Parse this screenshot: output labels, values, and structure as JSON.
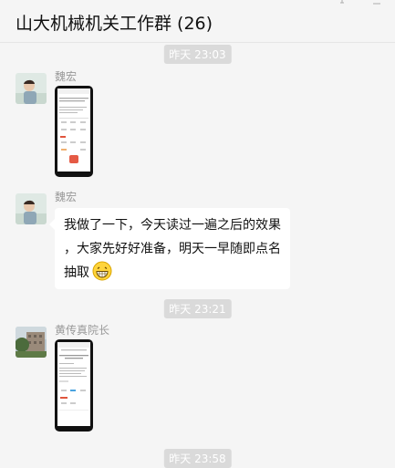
{
  "window": {
    "title": "山大机械机关工作群 (26)"
  },
  "messages": [
    {
      "type": "time",
      "text": "昨天 23:03"
    },
    {
      "type": "image",
      "sender": "魏宏",
      "avatar": "person-avatar",
      "image": "phone-screenshot-thumbnail"
    },
    {
      "type": "text",
      "sender": "魏宏",
      "avatar": "person-avatar",
      "lines": [
        "我做了一下，今天读过一遍之后的效果",
        "，大家先好好准备，明天一早随即点名",
        "抽取"
      ],
      "emoji": "grin-emoji"
    },
    {
      "type": "time",
      "text": "昨天 23:21"
    },
    {
      "type": "image",
      "sender": "黄传真院长",
      "avatar": "building-avatar",
      "image": "phone-screenshot-thumbnail"
    },
    {
      "type": "time",
      "text": "昨天 23:58"
    }
  ],
  "colors": {
    "background": "#f5f5f5",
    "bubble": "#ffffff",
    "time_badge": "#dadada",
    "sender_name": "#999999"
  }
}
